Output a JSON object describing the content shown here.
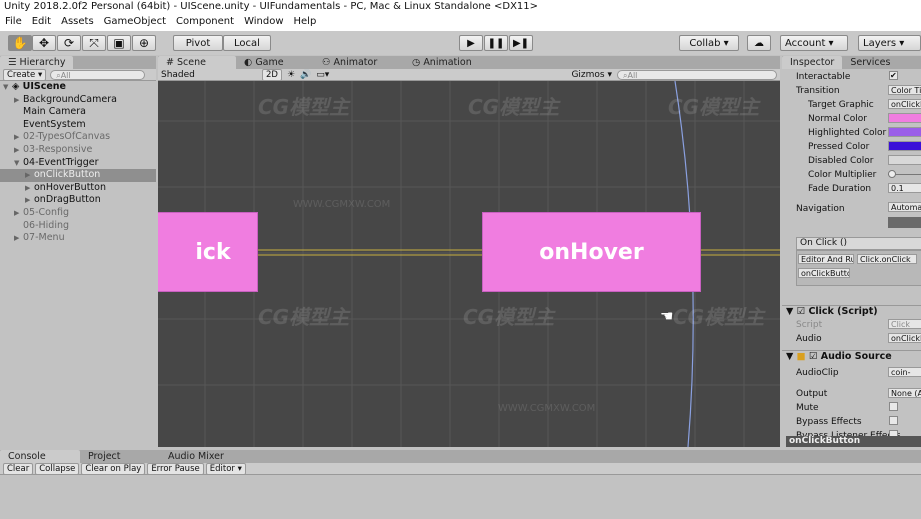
{
  "window": {
    "title": "Unity 2018.2.0f2 Personal (64bit) - UIScene.unity - UIFundamentals - PC, Mac & Linux Standalone <DX11>"
  },
  "menu": [
    "File",
    "Edit",
    "Assets",
    "GameObject",
    "Component",
    "Window",
    "Help"
  ],
  "toolbar": {
    "tools": [
      "hand-icon",
      "move-icon",
      "rotate-icon",
      "scale-icon",
      "rect-icon",
      "transform-icon"
    ],
    "pivot": "Pivot",
    "local": "Local",
    "collab": "Collab ▾",
    "account": "Account ▾",
    "layers": "Layers ▾"
  },
  "hierarchy": {
    "tab": "Hierarchy",
    "create": "Create ▾",
    "search_placeholder": "All",
    "scene": "UIScene",
    "items": [
      {
        "label": "BackgroundCamera",
        "depth": 1,
        "arrow": "▶",
        "state": ""
      },
      {
        "label": "Main Camera",
        "depth": 1,
        "arrow": "",
        "state": ""
      },
      {
        "label": "EventSystem",
        "depth": 1,
        "arrow": "",
        "state": ""
      },
      {
        "label": "02-TypesOfCanvas",
        "depth": 1,
        "arrow": "▶",
        "state": "dim"
      },
      {
        "label": "03-Responsive",
        "depth": 1,
        "arrow": "▶",
        "state": "dim"
      },
      {
        "label": "04-EventTrigger",
        "depth": 1,
        "arrow": "▼",
        "state": ""
      },
      {
        "label": "onClickButton",
        "depth": 2,
        "arrow": "▶",
        "state": "sel"
      },
      {
        "label": "onHoverButton",
        "depth": 2,
        "arrow": "▶",
        "state": ""
      },
      {
        "label": "onDragButton",
        "depth": 2,
        "arrow": "▶",
        "state": ""
      },
      {
        "label": "05-Config",
        "depth": 1,
        "arrow": "▶",
        "state": "dim"
      },
      {
        "label": "06-Hiding",
        "depth": 1,
        "arrow": "",
        "state": "dim"
      },
      {
        "label": "07-Menu",
        "depth": 1,
        "arrow": "▶",
        "state": "dim"
      }
    ]
  },
  "scene": {
    "tabs": [
      "Scene",
      "Game",
      "Animator",
      "Animation"
    ],
    "shading": "Shaded",
    "mode2d": "2D",
    "gizmos": "Gizmos ▾",
    "search_placeholder": "All",
    "button_left": "ick",
    "button_right": "onHover",
    "pink": "#f07de0"
  },
  "watermarks": [
    "CG模型主",
    "WWW.CGMXW.COM"
  ],
  "inspector": {
    "tabs": [
      "Inspector",
      "Services"
    ],
    "rows": [
      {
        "label": "Interactable",
        "value": "✔",
        "type": "check",
        "indent": 0
      },
      {
        "label": "Transition",
        "value": "Color Tint",
        "type": "field",
        "indent": 0
      },
      {
        "label": "Target Graphic",
        "value": "onClickButton",
        "type": "field",
        "indent": 1
      },
      {
        "label": "Normal Color",
        "value": "#f07de0",
        "type": "color",
        "indent": 1
      },
      {
        "label": "Highlighted Color",
        "value": "#9a5ee8",
        "type": "color",
        "indent": 1
      },
      {
        "label": "Pressed Color",
        "value": "#3a10d8",
        "type": "color",
        "indent": 1
      },
      {
        "label": "Disabled Color",
        "value": "#d8d8d8",
        "type": "color",
        "indent": 1
      },
      {
        "label": "Color Multiplier",
        "value": "",
        "type": "slider",
        "indent": 1
      },
      {
        "label": "Fade Duration",
        "value": "0.1",
        "type": "field",
        "indent": 1
      }
    ],
    "navigation": "Navigation",
    "navigation_value": "Automatic",
    "onclick": "On Click ()",
    "runtime": "Editor And Runtime",
    "func": "Click.onClick",
    "obj": "onClickButton",
    "click_script": "Click (Script)",
    "script_label": "Script",
    "script_value": "Click",
    "audio_label": "Audio",
    "audio_value": "onClickButton",
    "audio_source": "Audio Source",
    "audio_rows": [
      {
        "label": "AudioClip",
        "value": "coin-"
      },
      {
        "label": "Output",
        "value": "None (Audio Mixer Group)"
      },
      {
        "label": "Mute",
        "value": ""
      },
      {
        "label": "Bypass Effects",
        "value": ""
      },
      {
        "label": "Bypass Listener Effects",
        "value": ""
      }
    ],
    "footer": "onClickButton"
  },
  "console": {
    "tabs": [
      "Console",
      "Project",
      "Audio Mixer"
    ],
    "buttons": [
      "Clear",
      "Collapse",
      "Clear on Play",
      "Error Pause",
      "Editor ▾"
    ]
  }
}
